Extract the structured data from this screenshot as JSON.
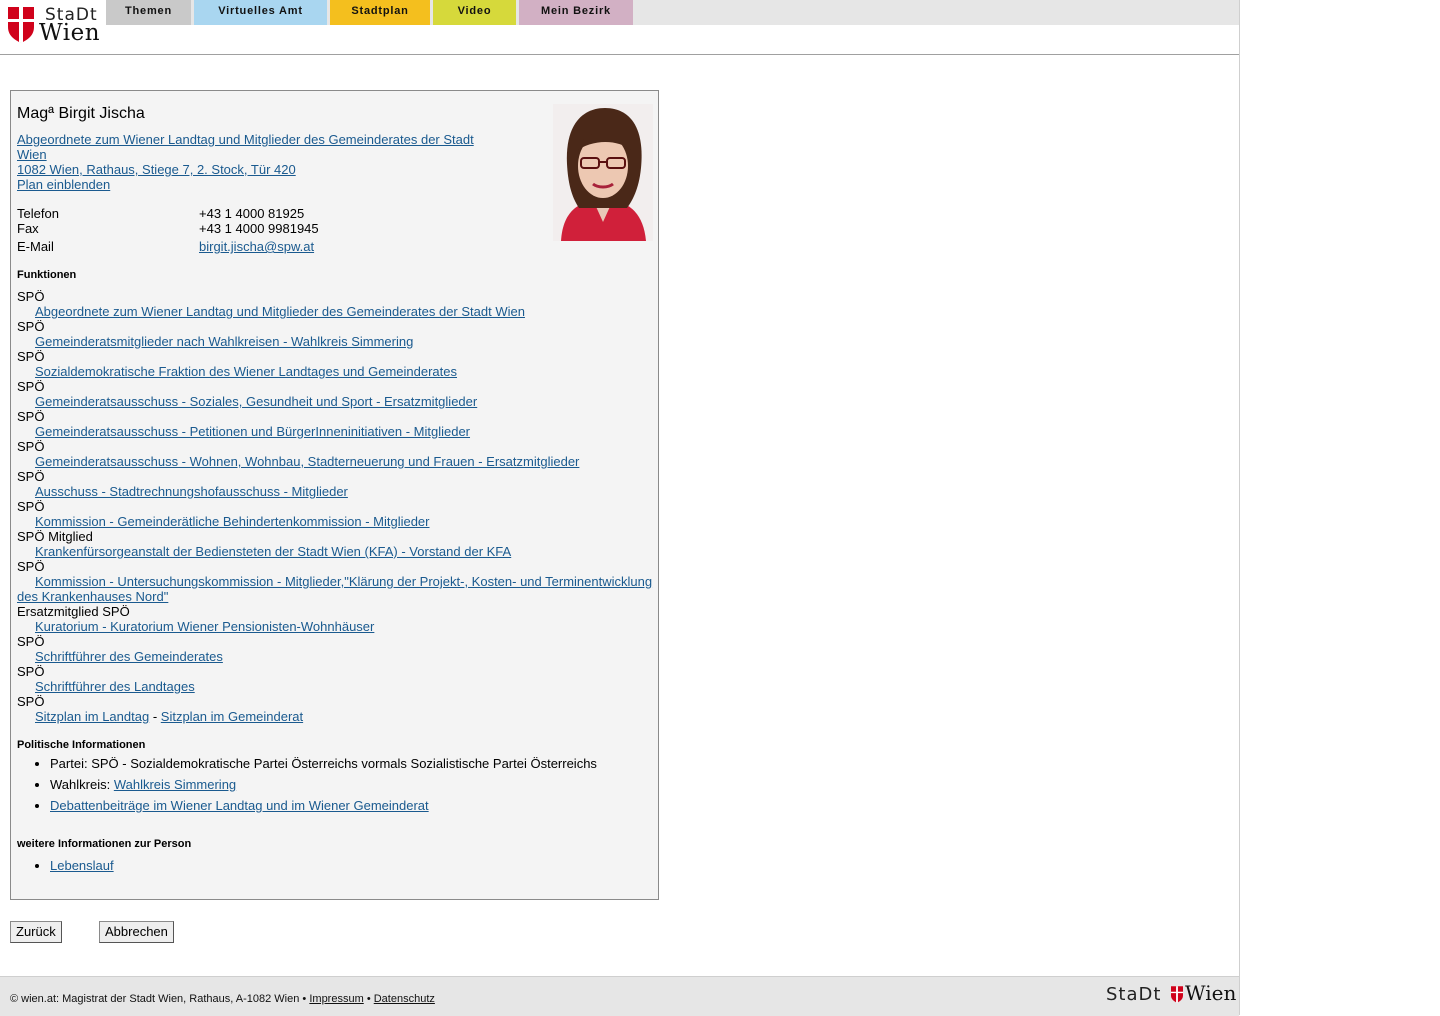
{
  "header": {
    "logo": {
      "line1": "StaDt",
      "line2": "Wien",
      "shield_colors": [
        "#d0021b",
        "#ffffff"
      ]
    },
    "tabs": [
      {
        "label": "Themen",
        "color": "#c9c9c9"
      },
      {
        "label": "Virtuelles Amt",
        "color": "#a9d6f0"
      },
      {
        "label": "Stadtplan",
        "color": "#f4bf1e"
      },
      {
        "label": "Video",
        "color": "#d6d93b"
      },
      {
        "label": "Mein Bezirk",
        "color": "#d2b0c4"
      }
    ]
  },
  "person": {
    "name": "Magª Birgit Jischa",
    "role_link": "Abgeordnete zum Wiener Landtag und Mitglieder des Gemeinderates der Stadt Wien",
    "address_link": "1082 Wien, Rathaus, Stiege 7, 2. Stock, Tür 420",
    "plan_link": "Plan einblenden",
    "contact": [
      {
        "label": "Telefon",
        "value": "+43 1 4000 81925",
        "is_link": false
      },
      {
        "label": "Fax",
        "value": "+43 1 4000 9981945",
        "is_link": false
      },
      {
        "label": "E-Mail",
        "value": "birgit.jischa@spw.at",
        "is_link": true
      }
    ]
  },
  "functions": {
    "heading": "Funktionen",
    "items": [
      {
        "party": "SPÖ",
        "link": "Abgeordnete zum Wiener Landtag und Mitglieder des Gemeinderates der Stadt Wien"
      },
      {
        "party": "SPÖ",
        "link": "Gemeinderatsmitglieder nach Wahlkreisen - Wahlkreis Simmering"
      },
      {
        "party": "SPÖ",
        "link": "Sozialdemokratische Fraktion des Wiener Landtages und Gemeinderates"
      },
      {
        "party": "SPÖ",
        "link": "Gemeinderatsausschuss - Soziales, Gesundheit und Sport - Ersatzmitglieder"
      },
      {
        "party": "SPÖ",
        "link": "Gemeinderatsausschuss - Petitionen und BürgerInneninitiativen - Mitglieder"
      },
      {
        "party": "SPÖ",
        "link": "Gemeinderatsausschuss - Wohnen, Wohnbau, Stadterneuerung und Frauen - Ersatzmitglieder"
      },
      {
        "party": "SPÖ",
        "link": "Ausschuss - Stadtrechnungshofausschuss - Mitglieder"
      },
      {
        "party": "SPÖ",
        "link": "Kommission - Gemeinderätliche Behindertenkommission - Mitglieder"
      },
      {
        "party": "SPÖ Mitglied",
        "link": "Krankenfürsorgeanstalt der Bediensteten der Stadt Wien (KFA) - Vorstand der KFA"
      },
      {
        "party": "SPÖ",
        "link": "Kommission - Untersuchungskommission - Mitglieder,\"Klärung der Projekt-, Kosten- und Terminentwicklung des Krankenhauses Nord\""
      },
      {
        "party": "Ersatzmitglied SPÖ",
        "link": "Kuratorium - Kuratorium Wiener Pensionisten-Wohnhäuser"
      },
      {
        "party": "SPÖ",
        "link": "Schriftführer des Gemeinderates"
      },
      {
        "party": "SPÖ",
        "link": "Schriftführer des Landtages"
      }
    ],
    "seating": {
      "party": "SPÖ",
      "link1": "Sitzplan im Landtag",
      "separator": "-",
      "link2": "Sitzplan im Gemeinderat"
    }
  },
  "political": {
    "heading": "Politische Informationen",
    "party_label": "Partei:",
    "party_value": "SPÖ - Sozialdemokratische Partei Österreichs vormals Sozialistische Partei Österreichs",
    "district_label": "Wahlkreis:",
    "district_link": "Wahlkreis Simmering",
    "debates_link": "Debattenbeiträge im Wiener Landtag und im Wiener Gemeinderat"
  },
  "more_info": {
    "heading": "weitere Informationen zur Person",
    "cv_link": "Lebenslauf"
  },
  "buttons": {
    "back": "Zurück",
    "cancel": "Abbrechen"
  },
  "footer": {
    "copyright": "© wien.at: Magistrat der Stadt Wien, Rathaus, A-1082 Wien",
    "bullet": "•",
    "imprint": "Impressum",
    "privacy": "Datenschutz",
    "logo_line1": "StaDt",
    "logo_line2": "Wien"
  }
}
